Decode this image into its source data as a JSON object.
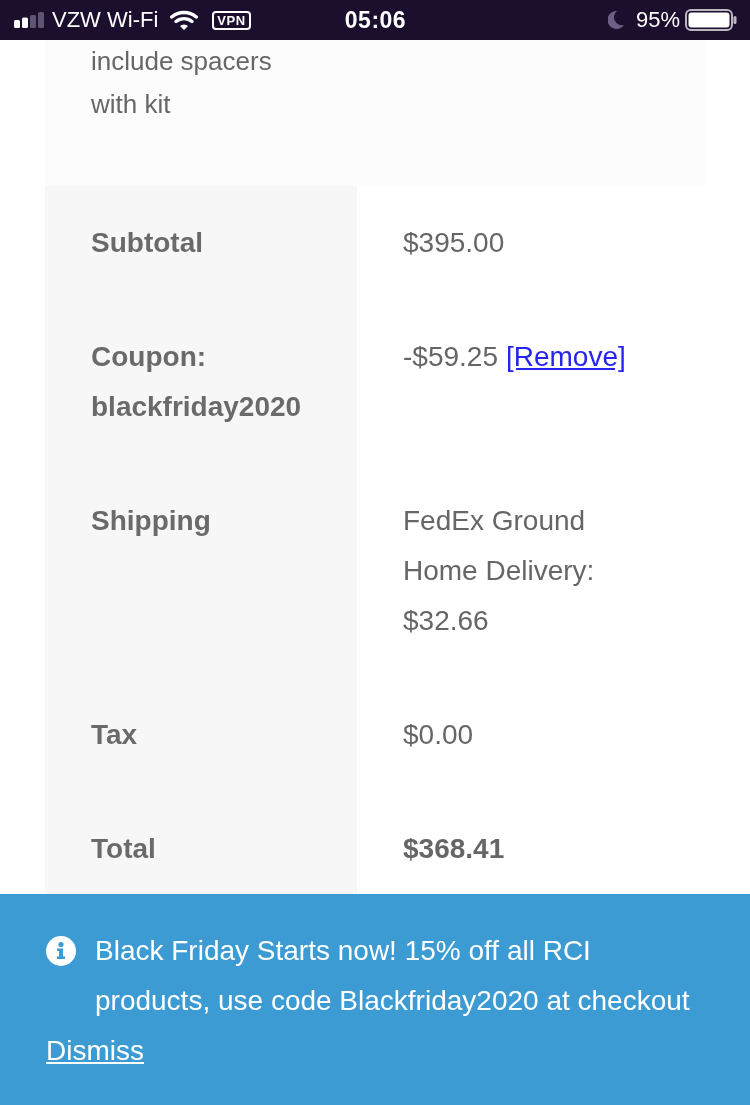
{
  "status_bar": {
    "carrier": "VZW Wi-Fi",
    "vpn": "VPN",
    "time": "05:06",
    "battery": "95%"
  },
  "item_note": {
    "text": "include spacers with kit"
  },
  "totals": [
    {
      "kind": "line",
      "label": "Subtotal",
      "value": "$395.00"
    },
    {
      "kind": "line",
      "label": "Coupon: blackfriday2020",
      "value": "-$59.25",
      "link": "[Remove]"
    },
    {
      "kind": "line",
      "label": "Shipping",
      "value": "FedEx Ground Home Delivery: $32.66"
    },
    {
      "kind": "line",
      "label": "Tax",
      "value": "$0.00"
    },
    {
      "kind": "total",
      "label": "Total",
      "value": "$368.41"
    }
  ],
  "notice": {
    "text": "Black Friday Starts now! 15% off all RCI products, use code Blackfriday2020 at checkout",
    "dismiss": "Dismiss"
  }
}
